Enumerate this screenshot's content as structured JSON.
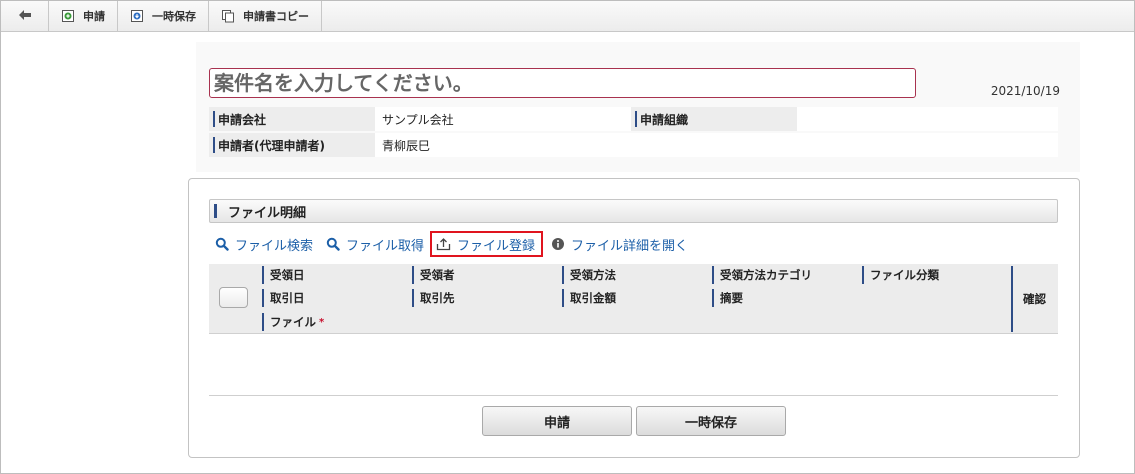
{
  "toolbar": {
    "items": [
      {
        "label": "申請",
        "icon": "apply-icon"
      },
      {
        "label": "一時保存",
        "icon": "save-icon"
      },
      {
        "label": "申請書コピー",
        "icon": "copy-icon"
      }
    ]
  },
  "header": {
    "title_placeholder": "案件名を入力してください。",
    "date": "2021/10/19",
    "company_label": "申請会社",
    "company_value": "サンプル会社",
    "org_label": "申請組織",
    "org_value": "",
    "applicant_label": "申請者(代理申請者)",
    "applicant_value": "青柳辰巳"
  },
  "section": {
    "title": "ファイル明細",
    "actions": [
      {
        "label": "ファイル検索",
        "icon": "search-icon"
      },
      {
        "label": "ファイル取得",
        "icon": "search-icon"
      },
      {
        "label": "ファイル登録",
        "icon": "upload-icon",
        "highlighted": true
      },
      {
        "label": "ファイル詳細を開く",
        "icon": "info-icon"
      }
    ],
    "columns_row1": [
      "受領日",
      "受領者",
      "受領方法",
      "受領方法カテゴリ",
      "ファイル分類"
    ],
    "columns_row2": [
      "取引日",
      "取引先",
      "取引金額",
      "摘要"
    ],
    "columns_row3": [
      "ファイル"
    ],
    "required_mark": "*",
    "confirm": "確認"
  },
  "footer": {
    "apply_label": "申請",
    "save_label": "一時保存"
  },
  "colors": {
    "accent_bar": "#2e4d87",
    "link": "#1c5fa8",
    "highlight": "#e0141e",
    "title_border": "#a8324f"
  }
}
